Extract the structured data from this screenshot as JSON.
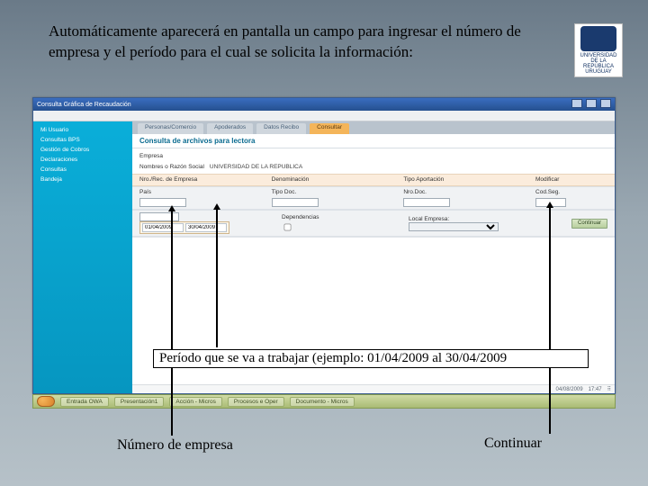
{
  "intro": "Automáticamente aparecerá en pantalla un campo para ingresar el número de empresa y el período para el cual se solicita la información:",
  "logo": {
    "line1": "UNIVERSIDAD",
    "line2": "DE LA REPÚBLICA",
    "line3": "URUGUAY"
  },
  "window": {
    "title": "Consulta Gráfica de Recaudación",
    "sidebar": {
      "items": [
        "Mi Usuario",
        "Consultas BPS",
        "Gestión de Cobros",
        "Declaraciones",
        "Consultas",
        "Bandeja"
      ]
    },
    "tabs": [
      {
        "label": "Personas/Comercio"
      },
      {
        "label": "Apoderados"
      },
      {
        "label": "Datos Recibo"
      },
      {
        "label": "Consultar",
        "active": true
      }
    ],
    "panel_title": "Consulta de archivos para lectora",
    "section1": {
      "emp_label": "Empresa",
      "nombre_label": "Nombres o Razón Social",
      "nombre_val": "UNIVERSIDAD DE LA REPUBLICA"
    },
    "paleband": {
      "nro_label": "Nro./Rec. de Empresa",
      "denom_label": "Denominación",
      "tipo_label": "Tipo Aportación",
      "mod_label": "Modificar"
    },
    "grayband": {
      "pais_label": "País",
      "tipodoc_label": "Tipo Doc.",
      "nrodoc_label": "Nro.Doc.",
      "cod_label": "Cod.Seg.",
      "deps_label": "Dependencias",
      "local_label": "Local Empresa:",
      "continuar_label": "Continuar"
    },
    "inputs": {
      "empresa": "",
      "periodo_desde": "01/04/2009",
      "periodo_hasta": "30/04/2009",
      "pais": "",
      "tipodoc": "",
      "nrodoc": "",
      "cod": ""
    },
    "status": {
      "date": "04/08/2009",
      "time": "17:47"
    }
  },
  "taskbar": {
    "items": [
      "Entrada OWA",
      "Presentación1",
      "Acción - Micros",
      "Procesos e Oper",
      "Documento - Micros"
    ]
  },
  "callouts": {
    "periodo": "Período que se va a trabajar (ejemplo: 01/04/2009 al 30/04/2009",
    "numero": "Número de empresa",
    "continuar": "Continuar"
  }
}
